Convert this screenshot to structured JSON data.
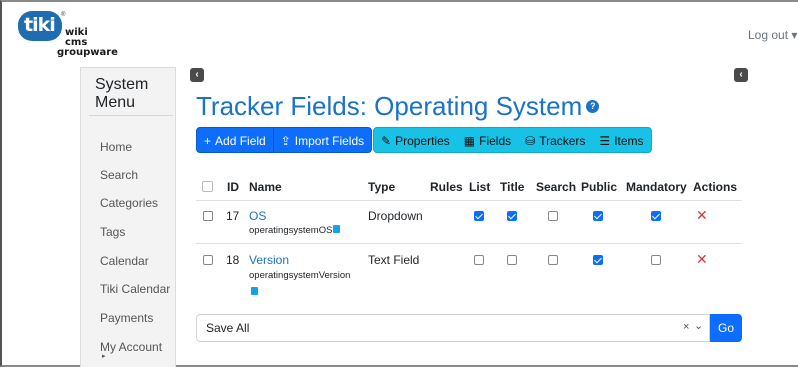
{
  "header": {
    "logo_mark": "tiki",
    "logo_tm": "®",
    "logo_line1": "wiki",
    "logo_line2": "cms",
    "logo_line3": "groupware",
    "logout_label": "Log out ▾"
  },
  "sidebar": {
    "title_line1": "System",
    "title_line2": "Menu",
    "items": [
      "Home",
      "Search",
      "Categories",
      "Tags",
      "Calendar",
      "Tiki Calendar",
      "Payments",
      "My Account"
    ],
    "caret": "▸"
  },
  "page": {
    "title": "Tracker Fields: Operating System",
    "help_icon": "?"
  },
  "toolbar": {
    "add_field": "Add Field",
    "import_fields": "Import Fields",
    "properties": "Properties",
    "fields": "Fields",
    "trackers": "Trackers",
    "items": "Items"
  },
  "table": {
    "headers": [
      "ID",
      "Name",
      "Type",
      "Rules",
      "List",
      "Title",
      "Search",
      "Public",
      "Mandatory",
      "Actions"
    ],
    "rows": [
      {
        "id": "17",
        "name": "OS",
        "perm_name": "operatingsystemOS",
        "type": "Dropdown",
        "list": true,
        "title": true,
        "search": false,
        "public": true,
        "mandatory": true
      },
      {
        "id": "18",
        "name": "Version",
        "perm_name": "operatingsystemVersion",
        "type": "Text Field",
        "list": false,
        "title": false,
        "search": false,
        "public": true,
        "mandatory": false
      }
    ],
    "delete_icon": "✕"
  },
  "bulk": {
    "selected": "Save All",
    "clear": "×",
    "chevron": "⌄",
    "go_label": "Go"
  },
  "colors": {
    "primary": "#0d6efd",
    "info": "#17c2e6",
    "title": "#1a73c7",
    "danger": "#dc3545"
  }
}
